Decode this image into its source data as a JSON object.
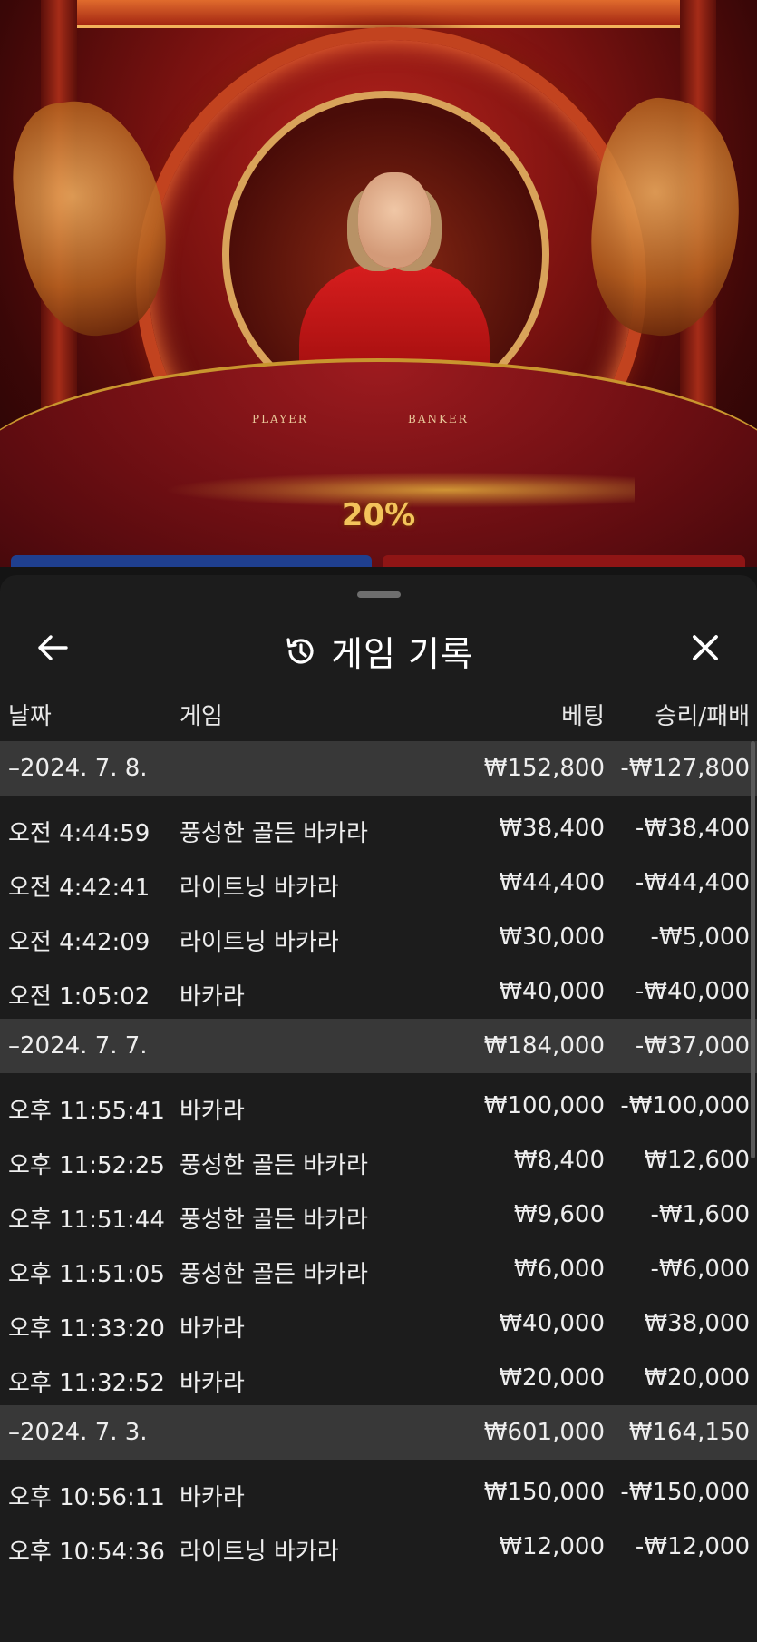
{
  "video": {
    "table_player": "PLAYER",
    "table_banker": "BANKER",
    "multiplier": "20%"
  },
  "sheet": {
    "title": "게임 기록",
    "icons": {
      "back": "arrow-left-icon",
      "history": "history-icon",
      "close": "close-icon"
    },
    "columns": {
      "date": "날짜",
      "game": "게임",
      "bet": "베팅",
      "result": "승리/패배"
    },
    "groups": [
      {
        "date": "–2024. 7. 8.",
        "bet": "₩152,800",
        "result": "-₩127,800",
        "items": [
          {
            "time": "오전 4:44:59",
            "game": "풍성한 골든 바카라",
            "bet": "₩38,400",
            "result": "-₩38,400"
          },
          {
            "time": "오전 4:42:41",
            "game": "라이트닝 바카라",
            "bet": "₩44,400",
            "result": "-₩44,400"
          },
          {
            "time": "오전 4:42:09",
            "game": "라이트닝 바카라",
            "bet": "₩30,000",
            "result": "-₩5,000"
          },
          {
            "time": "오전 1:05:02",
            "game": "바카라",
            "bet": "₩40,000",
            "result": "-₩40,000"
          }
        ]
      },
      {
        "date": "–2024. 7. 7.",
        "bet": "₩184,000",
        "result": "-₩37,000",
        "items": [
          {
            "time": "오후 11:55:41",
            "game": "바카라",
            "bet": "₩100,000",
            "result": "-₩100,000"
          },
          {
            "time": "오후 11:52:25",
            "game": "풍성한 골든 바카라",
            "bet": "₩8,400",
            "result": "₩12,600"
          },
          {
            "time": "오후 11:51:44",
            "game": "풍성한 골든 바카라",
            "bet": "₩9,600",
            "result": "-₩1,600"
          },
          {
            "time": "오후 11:51:05",
            "game": "풍성한 골든 바카라",
            "bet": "₩6,000",
            "result": "-₩6,000"
          },
          {
            "time": "오후 11:33:20",
            "game": "바카라",
            "bet": "₩40,000",
            "result": "₩38,000"
          },
          {
            "time": "오후 11:32:52",
            "game": "바카라",
            "bet": "₩20,000",
            "result": "₩20,000"
          }
        ]
      },
      {
        "date": "–2024. 7. 3.",
        "bet": "₩601,000",
        "result": "₩164,150",
        "items": [
          {
            "time": "오후 10:56:11",
            "game": "바카라",
            "bet": "₩150,000",
            "result": "-₩150,000"
          },
          {
            "time": "오후 10:54:36",
            "game": "라이트닝 바카라",
            "bet": "₩12,000",
            "result": "-₩12,000"
          }
        ]
      }
    ]
  }
}
